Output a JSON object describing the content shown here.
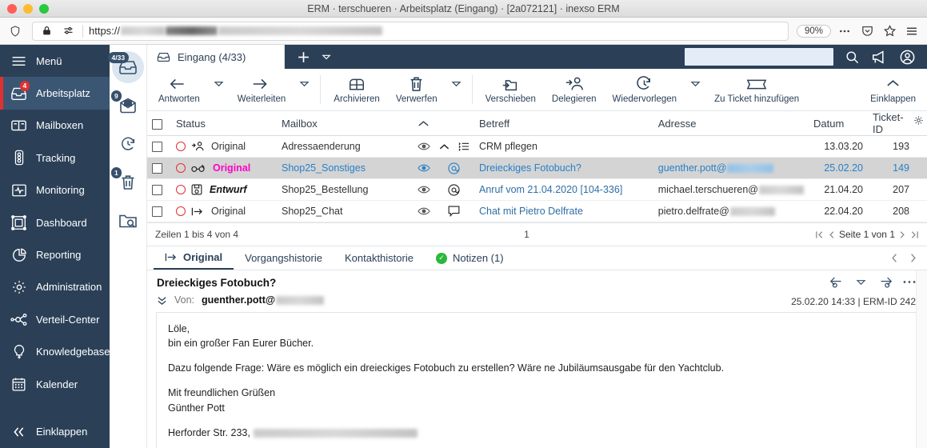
{
  "window": {
    "title": "ERM · terschueren · Arbeitsplatz (Eingang) · [2a072121] · inexso ERM"
  },
  "browser": {
    "url_scheme": "https://",
    "zoom_level": "90%",
    "shield_icon": "shield-icon",
    "lock_icon": "lock-icon",
    "permissions_icon": "permissions-icon",
    "more_icon": "ellipsis-icon",
    "pocket_icon": "pocket-icon",
    "bookmark_icon": "star-icon",
    "menu_icon": "hamburger-menu-icon"
  },
  "sidebar": {
    "menu_label": "Menü",
    "items": [
      {
        "label": "Arbeitsplatz",
        "icon": "inbox-tray-icon",
        "badge": "4",
        "active": true
      },
      {
        "label": "Mailboxen",
        "icon": "mailbox-icon",
        "badge": "",
        "active": false
      },
      {
        "label": "Tracking",
        "icon": "traffic-light-icon",
        "badge": "",
        "active": false
      },
      {
        "label": "Monitoring",
        "icon": "pulse-monitor-icon",
        "badge": "",
        "active": false
      },
      {
        "label": "Dashboard",
        "icon": "dashboard-icon",
        "badge": "",
        "active": false
      },
      {
        "label": "Reporting",
        "icon": "pie-chart-icon",
        "badge": "",
        "active": false
      },
      {
        "label": "Administration",
        "icon": "gear-icon",
        "badge": "",
        "active": false
      },
      {
        "label": "Verteil-Center",
        "icon": "distribution-icon",
        "badge": "",
        "active": false
      },
      {
        "label": "Knowledgebase",
        "icon": "lightbulb-icon",
        "badge": "",
        "active": false
      },
      {
        "label": "Kalender",
        "icon": "calendar-icon",
        "badge": "",
        "active": false
      }
    ],
    "collapse_label": "Einklappen"
  },
  "rail": {
    "items": [
      {
        "name": "inbox-rail-button",
        "badge": "4/33",
        "selected": true
      },
      {
        "name": "unread-mail-rail-button",
        "badge": "9",
        "selected": false
      },
      {
        "name": "resubmission-rail-button",
        "badge": "",
        "selected": false
      },
      {
        "name": "trash-rail-button",
        "badge": "1",
        "selected": false
      },
      {
        "name": "search-folder-rail-button",
        "badge": "",
        "selected": false
      }
    ]
  },
  "tabs": {
    "inbox_label": "Eingang (4/33)",
    "add_tab_icon": "plus-icon",
    "tab_dropdown_icon": "caret-down-icon"
  },
  "topbar": {
    "search_value": "",
    "search_placeholder": "",
    "search_icon": "magnifier-icon",
    "announce_icon": "megaphone-icon",
    "account_icon": "user-circle-icon"
  },
  "toolbar": {
    "items": [
      {
        "label": "Antworten",
        "icon": "reply-arrow-icon",
        "caret": true
      },
      {
        "label": "Weiterleiten",
        "icon": "forward-arrow-icon",
        "caret": true
      },
      {
        "label": "Archivieren",
        "icon": "archive-box-icon",
        "caret": false
      },
      {
        "label": "Verwerfen",
        "icon": "trash-icon",
        "caret": true
      },
      {
        "label": "Verschieben",
        "icon": "move-to-folder-icon",
        "caret": false
      },
      {
        "label": "Delegieren",
        "icon": "delegate-person-icon",
        "caret": false
      },
      {
        "label": "Wiedervorlegen",
        "icon": "clock-arrow-icon",
        "caret": true
      },
      {
        "label": "Zu Ticket hinzufügen",
        "icon": "ticket-icon",
        "caret": false
      }
    ],
    "collapse_label": "Einklappen",
    "collapse_icon": "chevron-up-icon"
  },
  "table": {
    "columns": [
      "Status",
      "Mailbox",
      "",
      "Betreff",
      "Adresse",
      "Datum",
      "Ticket-ID"
    ],
    "sort_icon": "chevron-up-icon",
    "settings_icon": "gear-icon",
    "rows": [
      {
        "status": "Original",
        "status_style": "normal",
        "status_icon": "delegate-person-icon",
        "mailbox": "Adressaenderung",
        "mailbox_link": false,
        "flags": [
          "eye-icon",
          "chevron-up-icon",
          "list-icon"
        ],
        "flags_blue": false,
        "subject": "CRM pflegen",
        "address": "",
        "address_blur": false,
        "date": "13.03.20",
        "ticket": "193",
        "selected": false
      },
      {
        "status": "Original",
        "status_style": "magenta",
        "status_icon": "glasses-icon",
        "mailbox": "Shop25_Sonstiges",
        "mailbox_link": true,
        "flags": [
          "eye-icon",
          "at-icon"
        ],
        "flags_blue": true,
        "subject": "Dreieckiges Fotobuch?",
        "address": "guenther.pott@",
        "address_blur": true,
        "date": "25.02.20",
        "ticket": "149",
        "selected": true
      },
      {
        "status": "Entwurf",
        "status_style": "draft",
        "status_icon": "save-disk-icon",
        "mailbox": "Shop25_Bestellung",
        "mailbox_link": false,
        "flags": [
          "eye-icon",
          "at-icon"
        ],
        "flags_blue": false,
        "subject": "Anruf vom 21.04.2020 [104-336]",
        "address": "michael.terschueren@",
        "address_blur": true,
        "date": "21.04.20",
        "ticket": "207",
        "selected": false
      },
      {
        "status": "Original",
        "status_style": "normal",
        "status_icon": "arrow-into-icon",
        "mailbox": "Shop25_Chat",
        "mailbox_link": false,
        "flags": [
          "eye-icon",
          "speech-bubble-icon"
        ],
        "flags_blue": false,
        "subject": "Chat mit Pietro Delfrate",
        "address": "pietro.delfrate@",
        "address_blur": true,
        "date": "22.04.20",
        "ticket": "208",
        "selected": false
      }
    ]
  },
  "pager": {
    "rows_text": "Zeilen 1 bis 4 von 4",
    "current_page_number": "1",
    "page_text": "Seite 1 von 1",
    "first_icon": "first-page-icon",
    "prev_icon": "prev-page-icon",
    "next_icon": "next-page-icon",
    "last_icon": "last-page-icon"
  },
  "detail_tabs": {
    "items": [
      {
        "label": "Original",
        "icon": "arrow-into-icon",
        "active": true,
        "check": false
      },
      {
        "label": "Vorgangshistorie",
        "icon": "",
        "active": false,
        "check": false
      },
      {
        "label": "Kontakthistorie",
        "icon": "",
        "active": false,
        "check": false
      },
      {
        "label": "Notizen (1)",
        "icon": "",
        "active": false,
        "check": true
      }
    ],
    "prev_icon": "chevron-left-icon",
    "next_icon": "chevron-right-icon"
  },
  "detail": {
    "subject": "Dreieckiges Fotobuch?",
    "from_label": "Von:",
    "from_value": "guenther.pott@",
    "expand_icon": "double-chevron-down-icon",
    "reply_icon": "reply-icon",
    "reply_caret_icon": "caret-down-icon",
    "forward_icon": "forward-icon",
    "more_icon": "ellipsis-icon",
    "meta": "25.02.20 14:33 | ERM-ID 242",
    "body": [
      "Löle,\nbin ein großer Fan Eurer Bücher.",
      "Dazu folgende Frage: Wäre es möglich ein dreieckiges Fotobuch zu erstellen? Wäre ne Jubiläumsausgabe für den Yachtclub.",
      "Mit freundlichen Grüßen\nGünther Pott",
      "Herforder Str. 233, "
    ]
  }
}
